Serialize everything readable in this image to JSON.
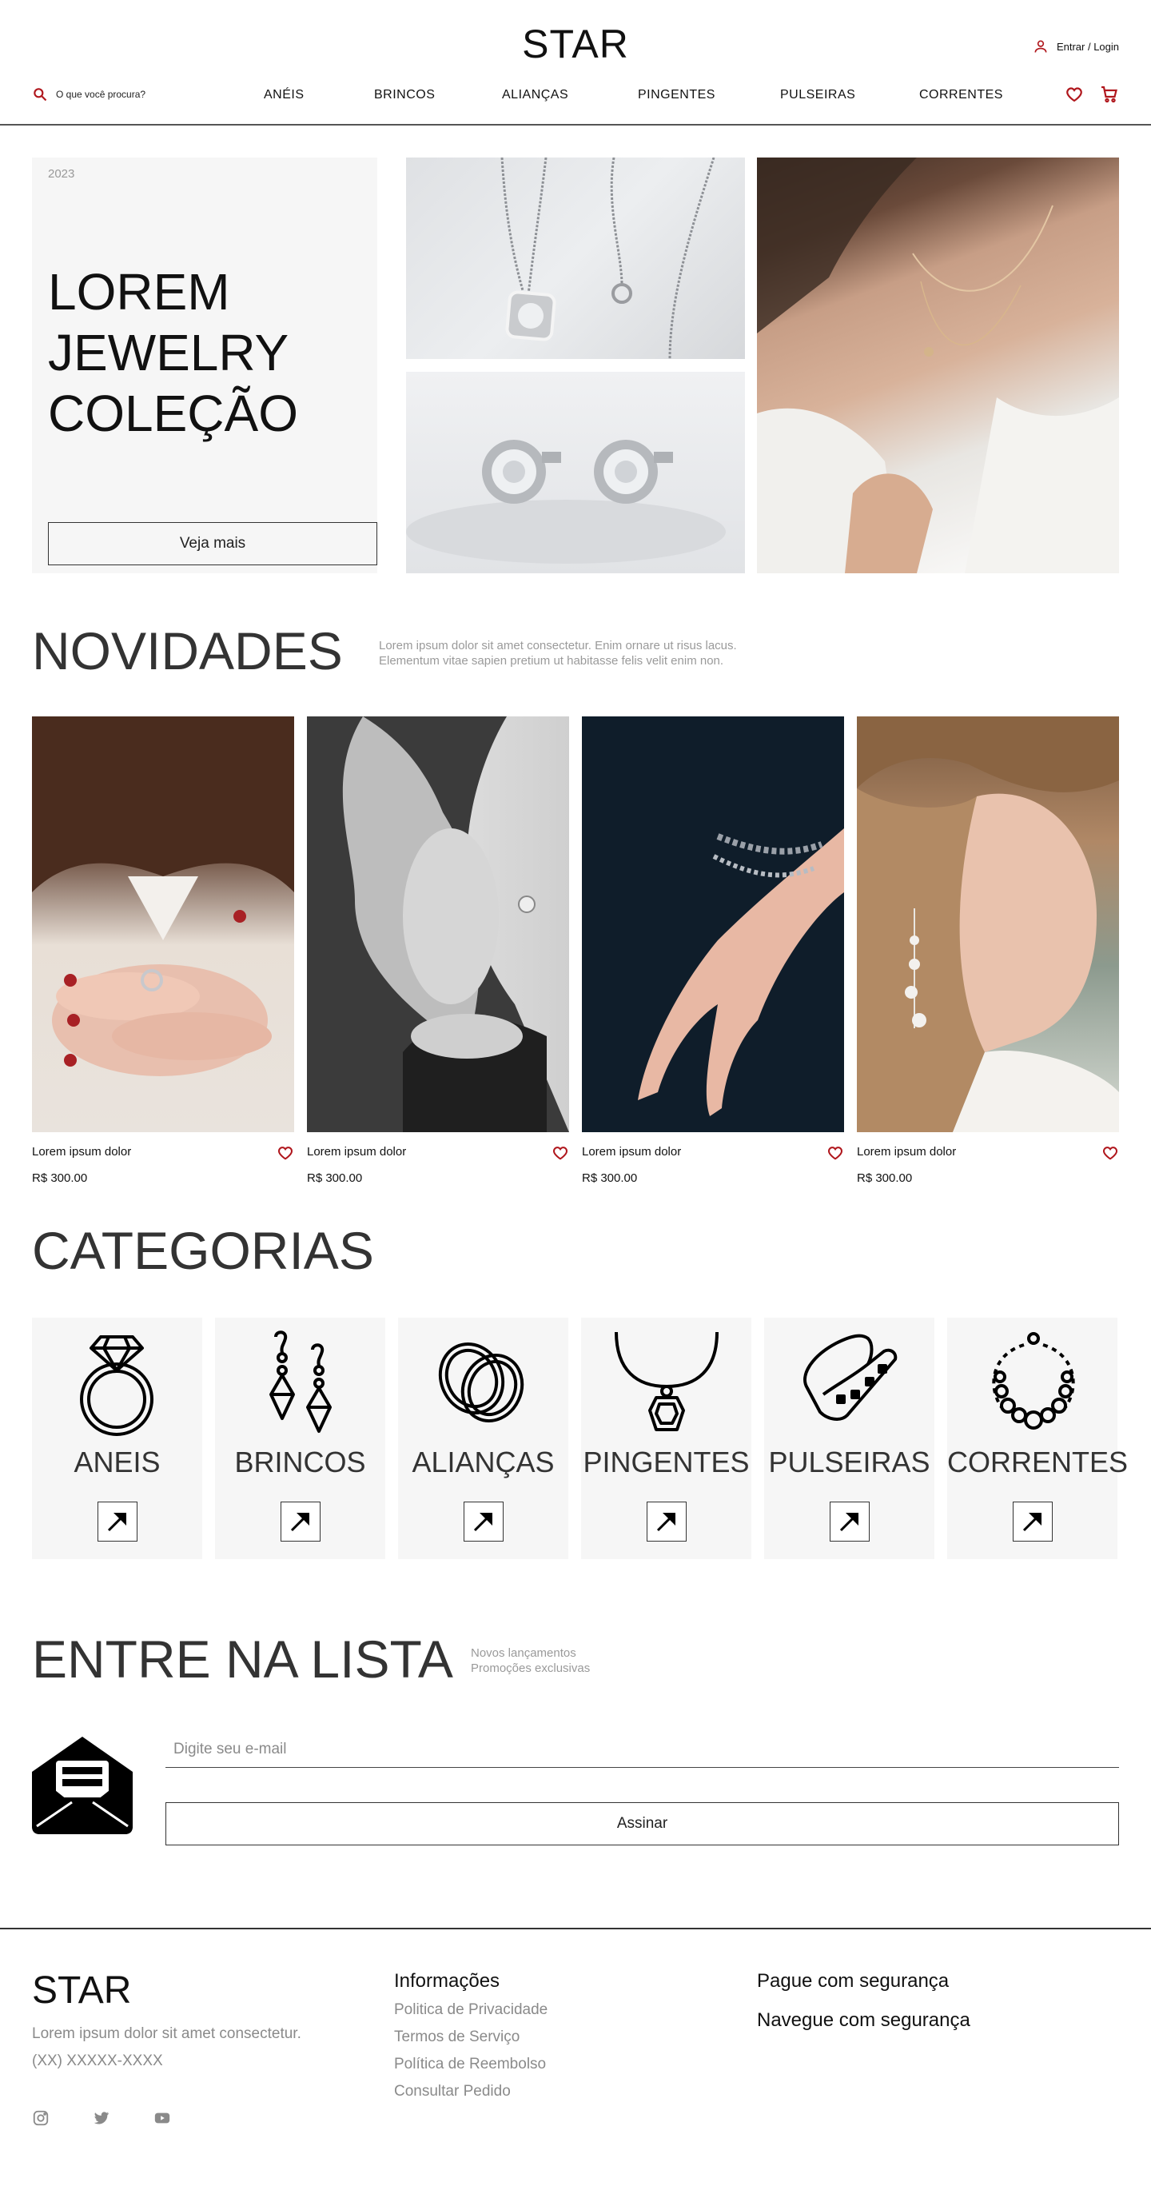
{
  "header": {
    "logo": "STAR",
    "login_label": "Entrar / Login",
    "search_placeholder": "O que você procura?",
    "nav": [
      "ANÉIS",
      "BRINCOS",
      "ALIANÇAS",
      "PINGENTES",
      "PULSEIRAS",
      "CORRENTES"
    ],
    "icons": [
      "user-icon",
      "search-icon",
      "heart-icon",
      "cart-icon"
    ]
  },
  "hero": {
    "year": "2023",
    "title_lines": [
      "LOREM",
      "JEWELRY",
      "COLEÇÃO"
    ],
    "cta_label": "Veja mais"
  },
  "novidades": {
    "title": "NOVIDADES",
    "lead_lines": [
      "Lorem ipsum dolor sit amet consectetur. Enim ornare ut risus lacus.",
      "Elementum vitae sapien pretium ut habitasse felis velit enim non."
    ],
    "products": [
      {
        "name": "Lorem ipsum dolor",
        "price": "R$ 300.00"
      },
      {
        "name": "Lorem ipsum dolor",
        "price": "R$ 300.00"
      },
      {
        "name": "Lorem ipsum dolor",
        "price": "R$ 300.00"
      },
      {
        "name": "Lorem ipsum dolor",
        "price": "R$ 300.00"
      }
    ]
  },
  "categorias": {
    "title": "CATEGORIAS",
    "items": [
      {
        "label": "ANEIS",
        "icon": "ring-icon"
      },
      {
        "label": "BRINCOS",
        "icon": "earrings-icon"
      },
      {
        "label": "ALIANÇAS",
        "icon": "wedding-rings-icon"
      },
      {
        "label": "PINGENTES",
        "icon": "pendant-icon"
      },
      {
        "label": "PULSEIRAS",
        "icon": "bracelet-icon"
      },
      {
        "label": "CORRENTES",
        "icon": "necklace-icon"
      }
    ]
  },
  "newsletter": {
    "title": "ENTRE NA LISTA",
    "lead_lines": [
      "Novos lançamentos",
      "Promoções exclusivas"
    ],
    "email_placeholder": "Digite seu e-mail",
    "submit_label": "Assinar"
  },
  "footer": {
    "logo": "STAR",
    "description": "Lorem ipsum dolor sit amet consectetur.",
    "phone": "(XX) XXXXX-XXXX",
    "info_title": "Informações",
    "info_links": [
      "Politica de Privacidade",
      "Termos de Serviço",
      "Política de Reembolso",
      "Consultar Pedido"
    ],
    "secure_pay": "Pague com segurança",
    "secure_browse": "Navegue com segurança",
    "social": [
      "instagram-icon",
      "twitter-icon",
      "youtube-icon"
    ]
  },
  "colors": {
    "accent": "#b0171d",
    "text": "#111111",
    "panel": "#f6f6f6",
    "muted": "#8a8a8a"
  }
}
